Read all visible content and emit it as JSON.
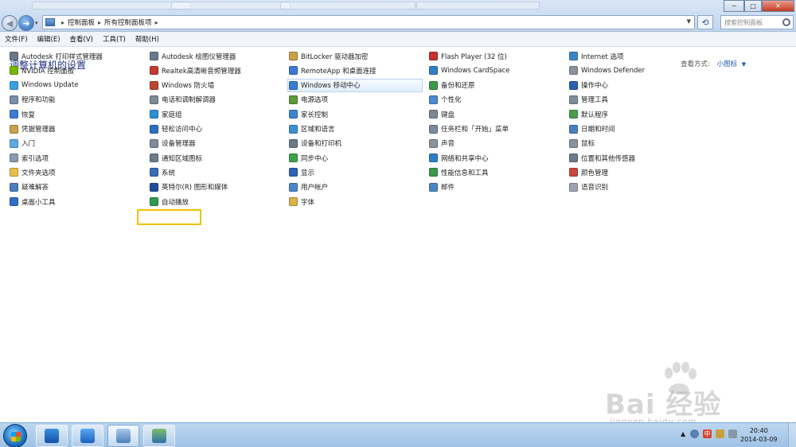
{
  "window": {
    "breadcrumb": [
      "控制面板",
      "所有控制面板项"
    ],
    "search_placeholder": "搜索控制面板",
    "controls": [
      "─",
      "□",
      "✕"
    ]
  },
  "menu": [
    "文件(F)",
    "编辑(E)",
    "查看(V)",
    "工具(T)",
    "帮助(H)"
  ],
  "page": {
    "title": "调整计算机的设置",
    "view_by_label": "查看方式:",
    "view_by_value": "小图标"
  },
  "columns": [
    [
      {
        "label": "Autodesk 打印样式管理器",
        "color": "#6a7a8c"
      },
      {
        "label": "NVIDIA 控制面板",
        "color": "#76b900"
      },
      {
        "label": "Windows Update",
        "color": "#3aa0e0"
      },
      {
        "label": "程序和功能",
        "color": "#7a8ea8"
      },
      {
        "label": "恢复",
        "color": "#3a7bd5"
      },
      {
        "label": "凭据管理器",
        "color": "#c9a24a"
      },
      {
        "label": "入门",
        "color": "#5da8e8"
      },
      {
        "label": "索引选项",
        "color": "#8a9bb0"
      },
      {
        "label": "文件夹选项",
        "color": "#e7c14b"
      },
      {
        "label": "疑难解答",
        "color": "#4a7fc1"
      },
      {
        "label": "桌面小工具",
        "color": "#2e6fc8"
      }
    ],
    [
      {
        "label": "Autodesk 绘图仪管理器",
        "color": "#6a7a8c"
      },
      {
        "label": "Realtek高清晰音频管理器",
        "color": "#c43a2f"
      },
      {
        "label": "Windows 防火墙",
        "color": "#b8472f"
      },
      {
        "label": "电话和调制解调器",
        "color": "#7c8a99"
      },
      {
        "label": "家庭组",
        "color": "#2f8fd3"
      },
      {
        "label": "轻松访问中心",
        "color": "#2a6fc0"
      },
      {
        "label": "设备管理器",
        "color": "#7f8c99"
      },
      {
        "label": "通知区域图标",
        "color": "#6b7c8f"
      },
      {
        "label": "系统",
        "color": "#3b6db5"
      },
      {
        "label": "英特尔(R) 图形和媒体",
        "color": "#1f4f9a"
      },
      {
        "label": "自动播放",
        "color": "#2f9a4a"
      }
    ],
    [
      {
        "label": "BitLocker 驱动器加密",
        "color": "#c9a24a"
      },
      {
        "label": "RemoteApp 和桌面连接",
        "color": "#3a7bd5"
      },
      {
        "label": "Windows 移动中心",
        "color": "#3a7bd5"
      },
      {
        "label": "电源选项",
        "color": "#5c9b3a"
      },
      {
        "label": "家长控制",
        "color": "#3a86d0"
      },
      {
        "label": "区域和语言",
        "color": "#3c8fd6"
      },
      {
        "label": "设备和打印机",
        "color": "#6b7a89"
      },
      {
        "label": "同步中心",
        "color": "#3ba24a"
      },
      {
        "label": "显示",
        "color": "#2d64b5"
      },
      {
        "label": "用户帐户",
        "color": "#4a86c8"
      },
      {
        "label": "字体",
        "color": "#d9b24a"
      }
    ],
    [
      {
        "label": "Flash Player (32 位)",
        "color": "#c8302a"
      },
      {
        "label": "Windows CardSpace",
        "color": "#2f7fc8"
      },
      {
        "label": "备份和还原",
        "color": "#3b9a4a"
      },
      {
        "label": "个性化",
        "color": "#4a8ad0"
      },
      {
        "label": "键盘",
        "color": "#7d8894"
      },
      {
        "label": "任务栏和「开始」菜单",
        "color": "#7a8aa0"
      },
      {
        "label": "声音",
        "color": "#8a949e"
      },
      {
        "label": "网络和共享中心",
        "color": "#2f7fc8"
      },
      {
        "label": "性能信息和工具",
        "color": "#3b9a4a"
      },
      {
        "label": "邮件",
        "color": "#4a86c8"
      }
    ],
    [
      {
        "label": "Internet 选项",
        "color": "#3a86c8"
      },
      {
        "label": "Windows Defender",
        "color": "#8a949e"
      },
      {
        "label": "操作中心",
        "color": "#2a5fb0"
      },
      {
        "label": "管理工具",
        "color": "#7f8c99"
      },
      {
        "label": "默认程序",
        "color": "#4aa04a"
      },
      {
        "label": "日期和时间",
        "color": "#4a7fc1"
      },
      {
        "label": "鼠标",
        "color": "#8a949e"
      },
      {
        "label": "位置和其他传感器",
        "color": "#6b7c8f"
      },
      {
        "label": "颜色管理",
        "color": "#c84a3a"
      },
      {
        "label": "语音识别",
        "color": "#9aa4ae"
      }
    ]
  ],
  "watermark": {
    "brand": "Bai 经验",
    "url": "jingyan.baidu.com"
  },
  "taskbar": {
    "time": "20:40",
    "date": "2014-03-09",
    "ime": "中"
  }
}
